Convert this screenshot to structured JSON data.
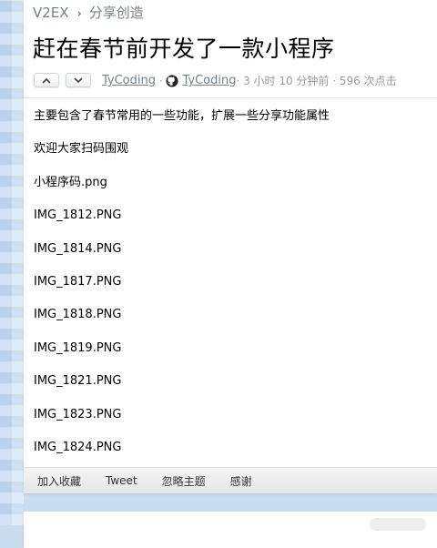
{
  "breadcrumb": {
    "site": "V2EX",
    "separator": "›",
    "node": "分享创造"
  },
  "topic": {
    "title": "赶在春节前开发了一款小程序",
    "author": "TyCoding",
    "github_user": "TyCoding",
    "meta_rest": " · 3 小时 10 分钟前 · 596 次点击"
  },
  "content": {
    "lines": [
      "主要包含了春节常用的一些功能，扩展一些分享功能属性",
      "欢迎大家扫码围观",
      "小程序码.png",
      "IMG_1812.PNG",
      "IMG_1814.PNG",
      "IMG_1817.PNG",
      "IMG_1818.PNG",
      "IMG_1819.PNG",
      "IMG_1821.PNG",
      "IMG_1823.PNG",
      "IMG_1824.PNG"
    ]
  },
  "footer": {
    "favorite": "加入收藏",
    "tweet": "Tweet",
    "ignore": "忽略主题",
    "thanks": "感谢"
  },
  "icons": {
    "upvote": "chevron-up-icon",
    "downvote": "chevron-down-icon",
    "github": "github-icon"
  },
  "colors": {
    "background": "#c9dcf0",
    "meta_gray": "#778087",
    "card": "#ffffff"
  }
}
